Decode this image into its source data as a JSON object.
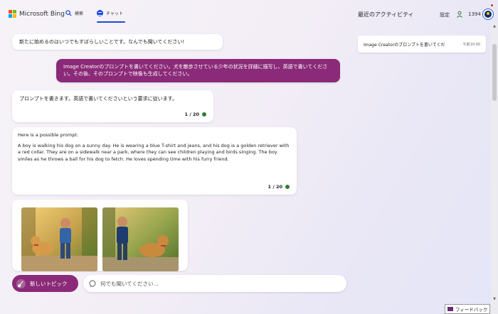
{
  "header": {
    "brand": "Microsoft Bing",
    "tabs": [
      {
        "label": "検索",
        "icon": "search-icon"
      },
      {
        "label": "チャット",
        "icon": "chat-icon",
        "active": true
      }
    ],
    "recent_activity_title": "最近のアクティビティ",
    "settings_label": "設定",
    "points": "1394"
  },
  "sidebar": {
    "activities": [
      {
        "title": "Image Creatorのプロンプトを書いてくだ",
        "time": "午前10:00"
      }
    ]
  },
  "chat": {
    "messages": [
      {
        "role": "bot",
        "text": "新たに始めるのはいつでもすばらしいことです。なんでも聞いてください!"
      },
      {
        "role": "user",
        "text": "Image Creatorのプロンプトを書いてください。犬を散歩させている少年の状況を詳細に描写し、英語で書いてください。その後、そのプロンプトで映像も生成してください。"
      },
      {
        "role": "bot",
        "text": "プロンプトを書きます。英語で書いてくださいという要求に従います。",
        "counter": "1 / 20"
      },
      {
        "role": "bot",
        "intro": "Here is a possible prompt:",
        "text": "A boy is walking his dog on a sunny day. He is wearing a blue T-shirt and jeans, and his dog is a golden retriever with a red collar. They are on a sidewalk near a park, where they can see children playing and birds singing. The boy smiles as he throws a ball for his dog to fetch. He loves spending time with his furry friend.",
        "counter": "1 / 20"
      }
    ]
  },
  "composer": {
    "new_topic_label": "新しいトピック",
    "placeholder": "何でも聞いてください..."
  },
  "feedback_label": "フィードバック",
  "colors": {
    "accent": "#8b2a78",
    "link_blue": "#174ae4",
    "status_green": "#2e7d32"
  }
}
